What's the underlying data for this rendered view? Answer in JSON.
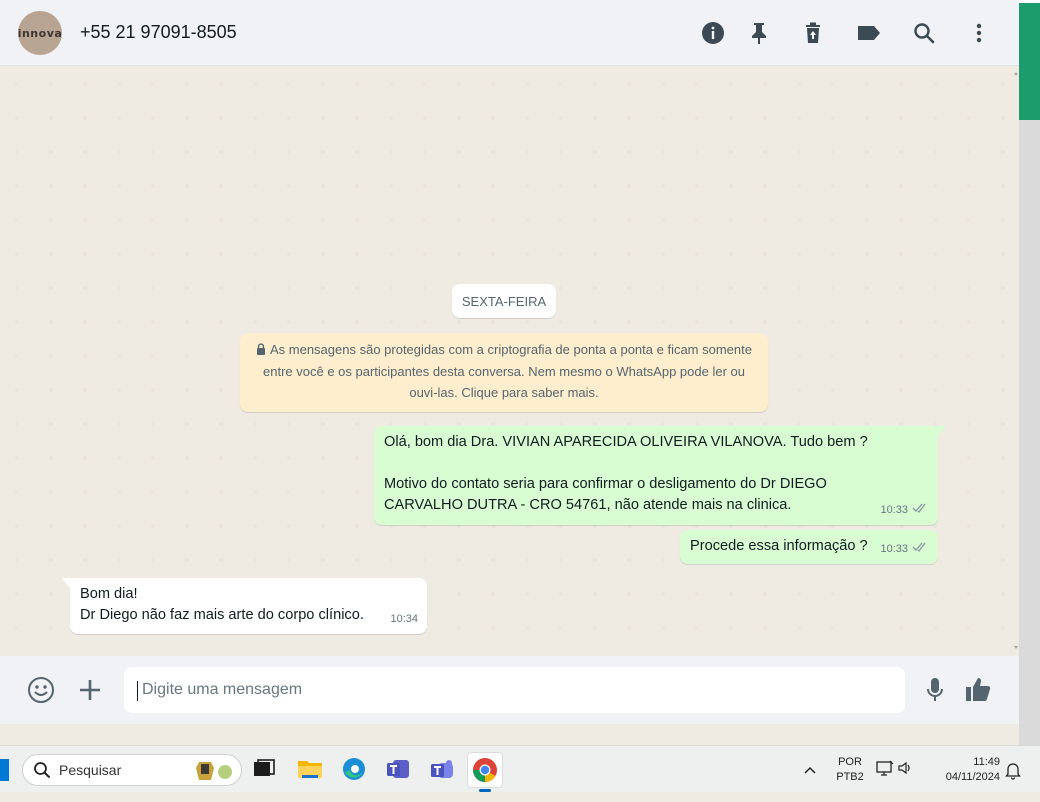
{
  "header": {
    "avatar_text": "innova",
    "contact_name": "+55 21 97091-8505",
    "icons": [
      "info-icon",
      "pin-icon",
      "delete-icon",
      "label-icon",
      "search-icon",
      "menu-icon"
    ]
  },
  "chat": {
    "date_label": "SEXTA-FEIRA",
    "encryption_notice": "As mensagens são protegidas com a criptografia de ponta a ponta e ficam somente entre você e os participantes desta conversa. Nem mesmo o WhatsApp pode ler ou ouvi-las. Clique para saber mais.",
    "messages": [
      {
        "direction": "out",
        "lines": [
          "Olá, bom dia Dra. VIVIAN APARECIDA OLIVEIRA VILANOVA. Tudo bem ?",
          "",
          "Motivo do contato seria para confirmar o desligamento do Dr DIEGO",
          "CARVALHO DUTRA - CRO 54761, não atende mais na clinica."
        ],
        "time": "10:33",
        "status": "read"
      },
      {
        "direction": "out",
        "lines": [
          "Procede essa informação ?"
        ],
        "time": "10:33",
        "status": "read"
      },
      {
        "direction": "in",
        "lines": [
          "Bom dia!",
          "Dr Diego não faz mais arte do corpo clínico."
        ],
        "time": "10:34"
      }
    ]
  },
  "composer": {
    "placeholder": "Digite uma mensagem"
  },
  "taskbar": {
    "search_placeholder": "Pesquisar",
    "lang_top": "POR",
    "lang_bottom": "PTB2",
    "time": "11:49",
    "date": "04/11/2024"
  },
  "colors": {
    "outgoing_bubble": "#d9fdd3",
    "incoming_bubble": "#ffffff",
    "encryption_notice_bg": "#ffeecd",
    "chat_bg": "#efeae2",
    "header_bg": "#f0f2f5",
    "accent": "#1c9b6c"
  }
}
